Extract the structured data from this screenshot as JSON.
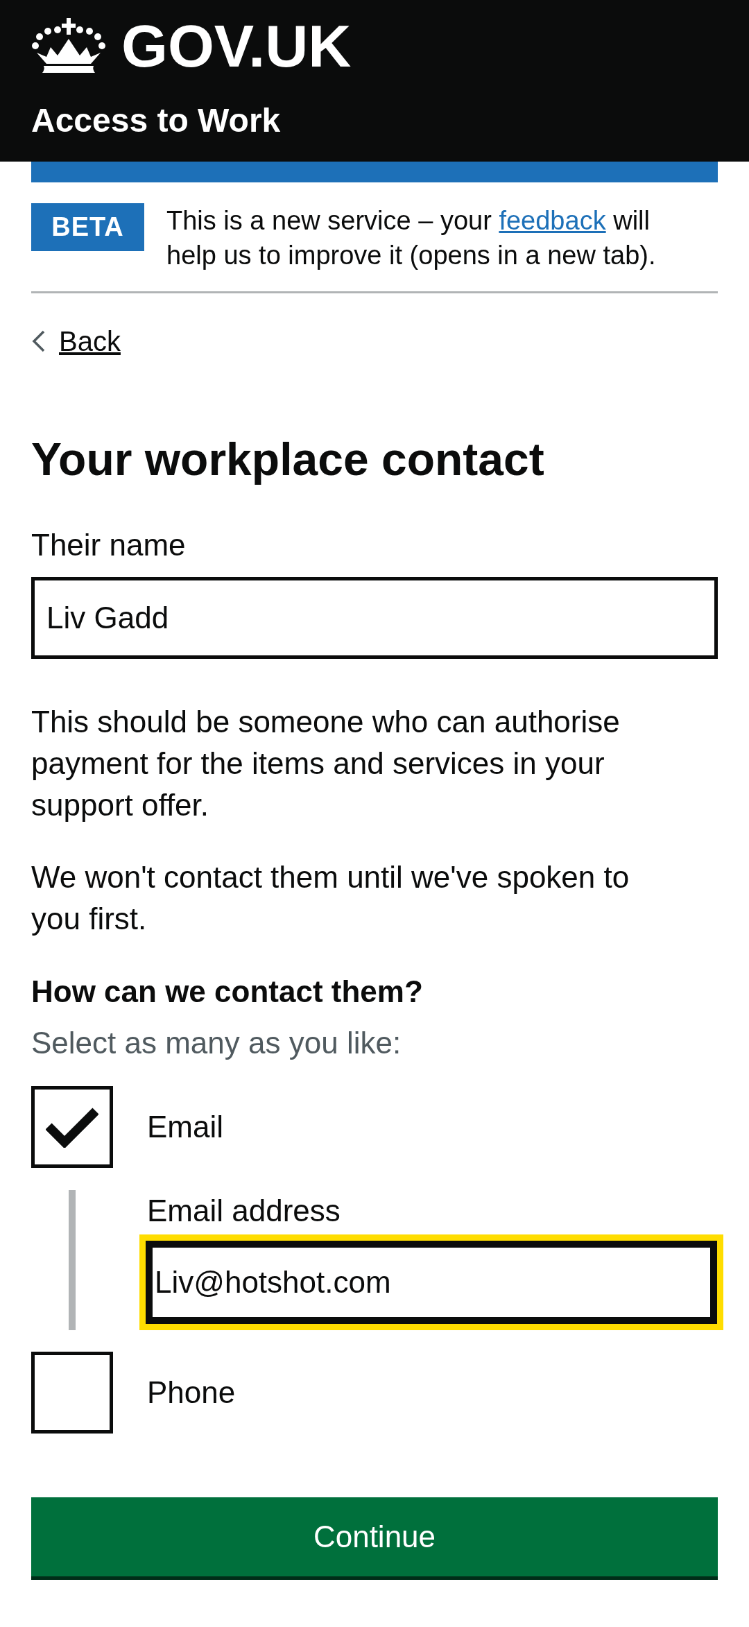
{
  "header": {
    "logo": "GOV.UK",
    "service_name": "Access to Work"
  },
  "phase_banner": {
    "tag": "BETA",
    "message_before": "This is a new service – your ",
    "link": "feedback",
    "message_after": " will help us to improve it (opens in a new tab)."
  },
  "back_link": "Back",
  "heading": "Your workplace contact",
  "name_field": {
    "label": "Their name",
    "value": "Liv Gadd"
  },
  "paragraphs": [
    "This should be someone who can authorise payment for the items and services in your support offer.",
    "We won't contact them until we've spoken to you first."
  ],
  "contact_question": {
    "legend": "How can we contact them?",
    "hint": "Select as many as you like:",
    "options": [
      {
        "label": "Email",
        "checked": true,
        "conditional": {
          "label": "Email address",
          "value": "Liv@hotshot.com",
          "focused": true
        }
      },
      {
        "label": "Phone",
        "checked": false
      }
    ]
  },
  "continue_button": "Continue"
}
